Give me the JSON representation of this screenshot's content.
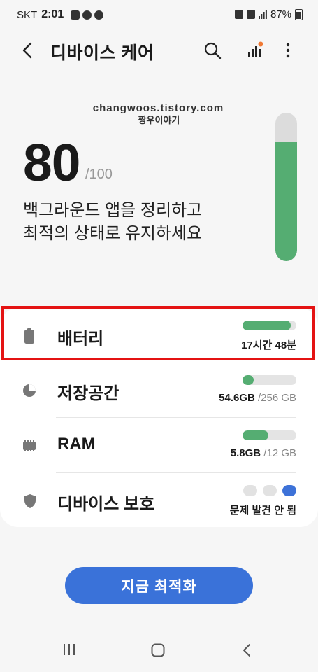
{
  "status_bar": {
    "carrier": "SKT",
    "time": "2:01",
    "battery_percent": "87%",
    "icons": [
      "gallery-icon",
      "chat-icon",
      "talk-icon",
      "alarm-icon",
      "5g-icon",
      "signal-icon",
      "battery-icon"
    ]
  },
  "app_bar": {
    "title": "디바이스 케어",
    "icons": [
      "back-icon",
      "search-icon",
      "signal-bars-icon",
      "more-vert-icon"
    ]
  },
  "watermark": {
    "line1": "changwoos.tistory.com",
    "line2": "짱우이야기"
  },
  "score": {
    "value": "80",
    "max": "/100",
    "fraction": 0.8,
    "message_line1": "백그라운드 앱을 정리하고",
    "message_line2": "최적의 상태로 유지하세요"
  },
  "items": [
    {
      "icon": "battery-icon",
      "label": "배터리",
      "used": "17시간 48분",
      "total": "",
      "fill": 0.9
    },
    {
      "icon": "pie-chart-icon",
      "label": "저장공간",
      "used": "54.6GB",
      "total": " /256 GB",
      "fill": 0.21
    },
    {
      "icon": "memory-chip-icon",
      "label": "RAM",
      "used": "5.8GB",
      "total": " /12 GB",
      "fill": 0.48
    },
    {
      "icon": "shield-icon",
      "label": "디바이스 보호",
      "status": "문제 발견 안 됨",
      "dots_active": 3
    }
  ],
  "action": {
    "label": "지금 최적화"
  },
  "colors": {
    "accent_blue": "#3a72d9",
    "gauge_green": "#55ad72",
    "highlight_red": "#e41313",
    "notification_orange": "#f07a35"
  }
}
